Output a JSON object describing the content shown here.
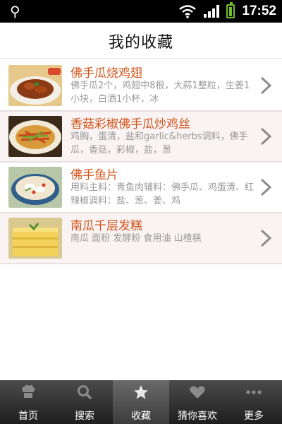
{
  "status_bar": {
    "time": "17:52"
  },
  "header": {
    "title": "我的收藏"
  },
  "favorites": [
    {
      "name": "佛手瓜烧鸡翅",
      "desc": "佛手瓜2个，鸡翅中8根，大蒜1整粒，生姜1小块，白酒1小杯，冰"
    },
    {
      "name": "香菇彩椒佛手瓜炒鸡丝",
      "desc": "鸡胸，蛋清，盐和garlic&herbs调料，佛手瓜，香菇，彩椒，盐，葱"
    },
    {
      "name": "佛手鱼片",
      "desc": "用料主料：青鱼肉辅料：佛手瓜、鸡蛋清、红辣椒调料：盐、葱、姜、鸡"
    },
    {
      "name": "南瓜千层发糕",
      "desc": "南瓜 面粉 发酵粉 食用油 山楂糕"
    }
  ],
  "tabbar": {
    "tabs": [
      {
        "label": "首页",
        "icon": "chef-hat-icon"
      },
      {
        "label": "搜索",
        "icon": "search-icon"
      },
      {
        "label": "收藏",
        "icon": "star-icon",
        "active": true
      },
      {
        "label": "猜你喜欢",
        "icon": "heart-icon"
      },
      {
        "label": "更多",
        "icon": "more-dots-icon"
      }
    ]
  },
  "colors": {
    "item_title": "#d2551a",
    "item_desc": "#9a9a9a",
    "tabbar_bg": "#2e2e2e",
    "tab_active_bg": "#555555"
  }
}
